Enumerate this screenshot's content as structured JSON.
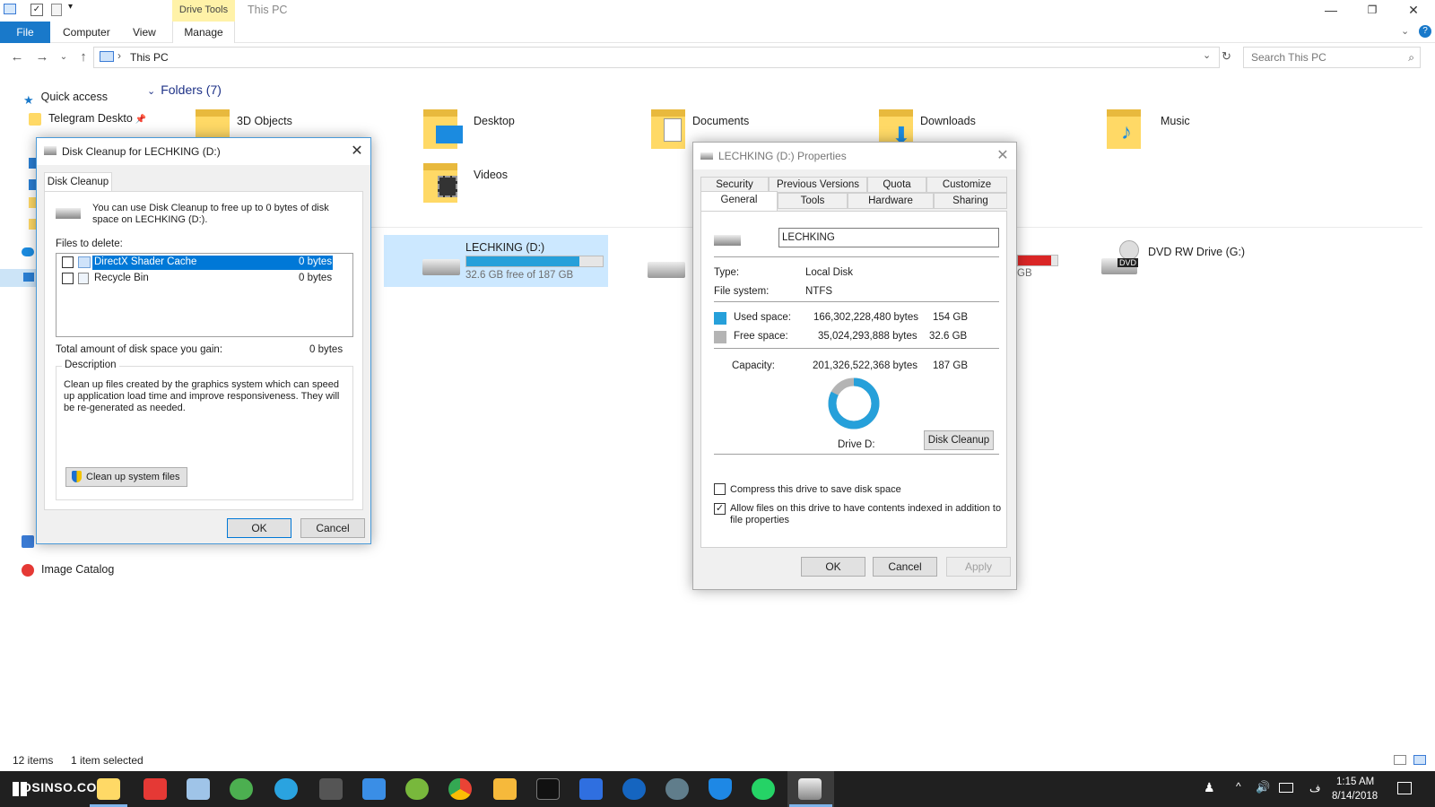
{
  "ribbon": {
    "context_group": "Drive Tools",
    "window_title": "This PC",
    "tabs": [
      "File",
      "Computer",
      "View",
      "Manage"
    ]
  },
  "address": {
    "path": "This PC",
    "search_placeholder": "Search This PC"
  },
  "nav": {
    "items": [
      "Quick access",
      "Telegram Deskto",
      "Network",
      "Image Catalog"
    ]
  },
  "content": {
    "folders_header": "Folders (7)",
    "folders": [
      "3D Objects",
      "Desktop",
      "Documents",
      "Downloads",
      "Music",
      "Videos"
    ],
    "drive_d": {
      "name": "LECHKING (D:)",
      "free": "32.6 GB free of 187 GB",
      "used_fraction": 0.83
    },
    "partial_drive_free": "GB",
    "partial_drive_used_fraction": 0.85,
    "dvd": {
      "name": "DVD RW Drive (G:)",
      "badge": "DVD"
    }
  },
  "cleanup": {
    "title": "Disk Cleanup for LECHKING (D:)",
    "tab": "Disk Cleanup",
    "intro": "You can use Disk Cleanup to free up to 0 bytes of disk space on LECHKING (D:).",
    "files_label": "Files to delete:",
    "files": [
      {
        "name": "DirectX Shader Cache",
        "size": "0 bytes"
      },
      {
        "name": "Recycle Bin",
        "size": "0 bytes"
      }
    ],
    "total_label": "Total amount of disk space you gain:",
    "total_value": "0 bytes",
    "desc_label": "Description",
    "desc_text": "Clean up files created by the graphics system which can speed up application load time and improve responsiveness. They will be re-generated as needed.",
    "cleanup_system": "Clean up system files",
    "ok": "OK",
    "cancel": "Cancel"
  },
  "props": {
    "title": "LECHKING (D:) Properties",
    "tabs_row1": [
      "Security",
      "Previous Versions",
      "Quota",
      "Customize"
    ],
    "tabs_row2": [
      "General",
      "Tools",
      "Hardware",
      "Sharing"
    ],
    "name_value": "LECHKING",
    "type_label": "Type:",
    "type_value": "Local Disk",
    "fs_label": "File system:",
    "fs_value": "NTFS",
    "used_label": "Used space:",
    "used_bytes": "166,302,228,480 bytes",
    "used_gb": "154 GB",
    "free_label": "Free space:",
    "free_bytes": "35,024,293,888 bytes",
    "free_gb": "32.6 GB",
    "cap_label": "Capacity:",
    "cap_bytes": "201,326,522,368 bytes",
    "cap_gb": "187 GB",
    "drive_label": "Drive D:",
    "disk_cleanup": "Disk Cleanup",
    "compress": "Compress this drive to save disk space",
    "index_line1": "Allow files on this drive to have contents indexed in addition to",
    "index_line2": "file properties",
    "ok": "OK",
    "cancel": "Cancel",
    "apply": "Apply",
    "used_fraction": 0.826,
    "colors": {
      "used": "#26a0da",
      "free": "#b4b4b4"
    }
  },
  "status": {
    "items": "12 items",
    "selected": "1 item selected"
  },
  "taskbar": {
    "watermark": "OSINSO.COM",
    "time": "1:15 AM",
    "date": "8/14/2018",
    "lang": "ف"
  }
}
